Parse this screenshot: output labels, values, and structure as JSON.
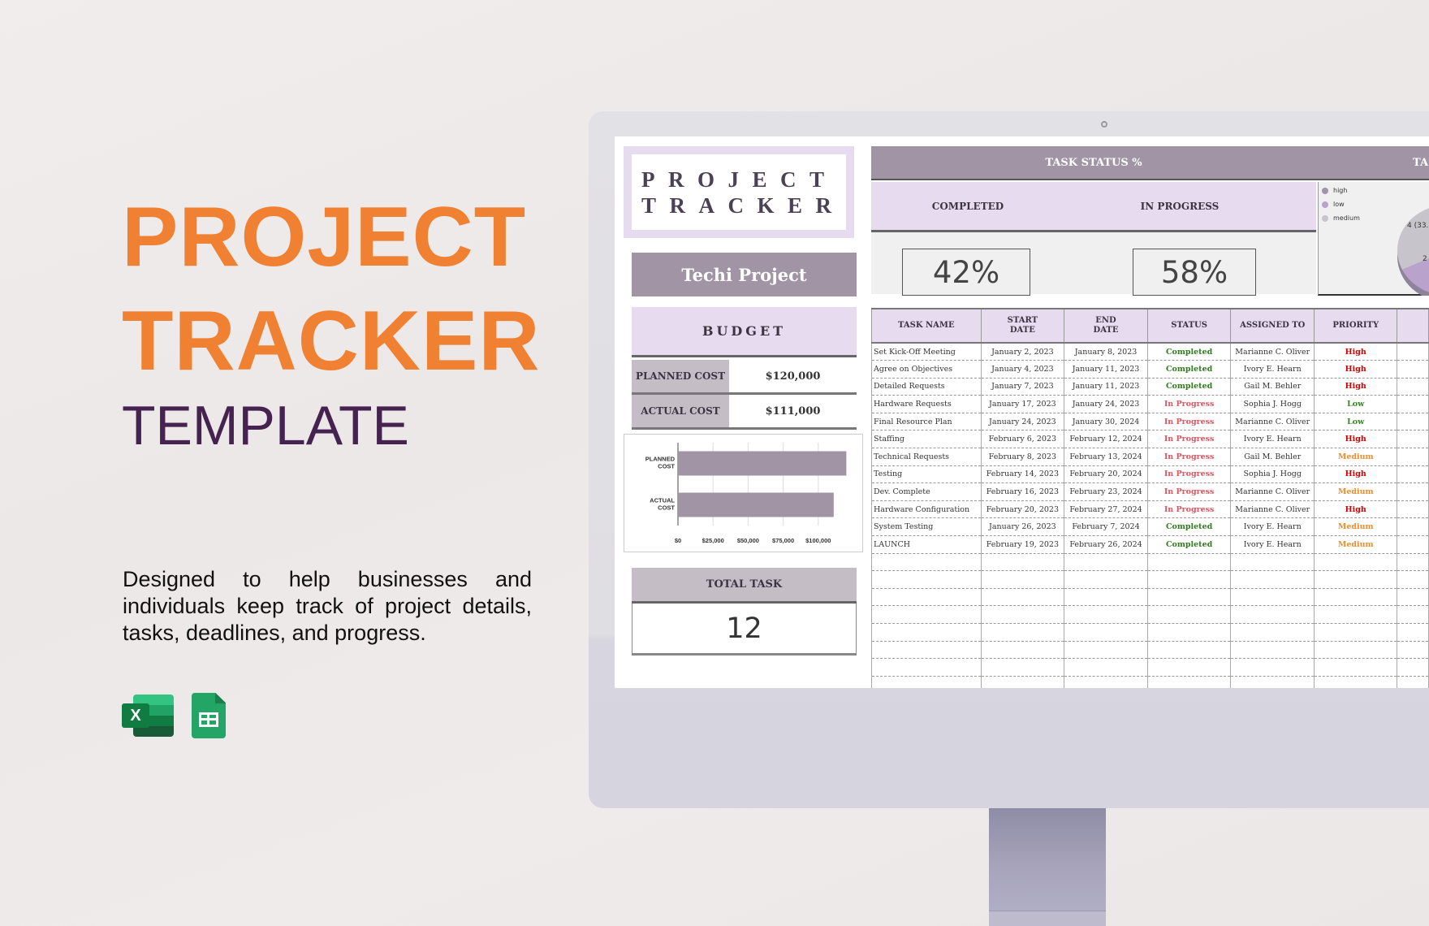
{
  "promo": {
    "title_line1": "PROJECT",
    "title_line2": "TRACKER",
    "subtitle": "TEMPLATE",
    "description": "Designed to help businesses and individuals keep track of project details, tasks, deadlines, and progress.",
    "colors": {
      "title": "#f18132",
      "subtitle": "#45224f"
    },
    "app_icons": [
      "excel-icon",
      "google-sheets-icon"
    ],
    "excel_letter": "X"
  },
  "tracker": {
    "logo_line1": "PROJECT",
    "logo_line2": "TRACKER",
    "project_name": "Techi Project",
    "budget": {
      "heading": "BUDGET",
      "rows": [
        {
          "label": "PLANNED COST",
          "value": "$120,000"
        },
        {
          "label": "ACTUAL COST",
          "value": "$111,000"
        }
      ]
    },
    "total_task": {
      "label": "TOTAL TASK",
      "value": "12"
    },
    "task_status": {
      "title": "TASK STATUS %",
      "title_right_partial": "TAS",
      "columns": [
        {
          "label": "COMPLETED",
          "value": "42%"
        },
        {
          "label": "IN PROGRESS",
          "value": "58%"
        }
      ]
    },
    "priority_chart": {
      "legend": [
        {
          "label": "high",
          "color": "#a093a8"
        },
        {
          "label": "low",
          "color": "#b9a3cc"
        },
        {
          "label": "medium",
          "color": "#c8c4cb"
        }
      ],
      "visible_labels": [
        "4 (33.",
        "2"
      ]
    },
    "table": {
      "headers": [
        "TASK NAME",
        "START\nDATE",
        "END\nDATE",
        "STATUS",
        "ASSIGNED TO",
        "PRIORITY",
        ""
      ],
      "rows": [
        {
          "name": "Set Kick-Off Meeting",
          "start": "January 2, 2023",
          "end": "January 8, 2023",
          "status": "Completed",
          "assigned": "Marianne C. Oliver",
          "priority": "High"
        },
        {
          "name": "Agree on Objectives",
          "start": "January 4, 2023",
          "end": "January 11, 2023",
          "status": "Completed",
          "assigned": "Ivory E. Hearn",
          "priority": "High"
        },
        {
          "name": "Detailed Requests",
          "start": "January 7, 2023",
          "end": "January 11, 2023",
          "status": "Completed",
          "assigned": "Gail M. Behler",
          "priority": "High"
        },
        {
          "name": "Hardware Requests",
          "start": "January 17, 2023",
          "end": "January 24, 2023",
          "status": "In Progress",
          "assigned": "Sophia J. Hogg",
          "priority": "Low"
        },
        {
          "name": "Final Resource Plan",
          "start": "January 24, 2023",
          "end": "January 30, 2024",
          "status": "In Progress",
          "assigned": "Marianne C. Oliver",
          "priority": "Low"
        },
        {
          "name": "Staffing",
          "start": "February 6, 2023",
          "end": "February 12, 2024",
          "status": "In Progress",
          "assigned": "Ivory E. Hearn",
          "priority": "High"
        },
        {
          "name": "Technical Requests",
          "start": "February 8, 2023",
          "end": "February 13, 2024",
          "status": "In Progress",
          "assigned": "Gail M. Behler",
          "priority": "Medium"
        },
        {
          "name": "Testing",
          "start": "February 14, 2023",
          "end": "February 20, 2024",
          "status": "In Progress",
          "assigned": "Sophia J. Hogg",
          "priority": "High"
        },
        {
          "name": "Dev. Complete",
          "start": "February 16, 2023",
          "end": "February 23, 2024",
          "status": "In Progress",
          "assigned": "Marianne C. Oliver",
          "priority": "Medium"
        },
        {
          "name": "Hardware Configuration",
          "start": "February 20, 2023",
          "end": "February 27, 2024",
          "status": "In Progress",
          "assigned": "Marianne C. Oliver",
          "priority": "High"
        },
        {
          "name": "System Testing",
          "start": "January 26, 2023",
          "end": "February 7, 2024",
          "status": "Completed",
          "assigned": "Ivory E. Hearn",
          "priority": "Medium"
        },
        {
          "name": "LAUNCH",
          "start": "February 19, 2023",
          "end": "February 26, 2024",
          "status": "Completed",
          "assigned": "Ivory E. Hearn",
          "priority": "Medium"
        }
      ],
      "empty_rows": 8
    },
    "colors": {
      "header_mauve": "#a094a5",
      "header_lilac": "#e7dbef",
      "label_gray": "#c4bdc6",
      "status_completed": "#2f7d1e",
      "status_in_progress": "#e0545e",
      "priority_high": "#d40000",
      "priority_low": "#2f8a1e",
      "priority_medium": "#ef8c2a"
    }
  },
  "chart_data": {
    "type": "bar",
    "orientation": "horizontal",
    "title": "",
    "categories": [
      "PLANNED\nCOST",
      "ACTUAL\nCOST"
    ],
    "values": [
      120000,
      111000
    ],
    "xlabel": "",
    "ylabel": "",
    "xlim": [
      0,
      125000
    ],
    "xticks": [
      0,
      25000,
      50000,
      75000,
      100000
    ],
    "xtick_labels": [
      "$0",
      "$25,000",
      "$50,000",
      "$75,000",
      "$100,000"
    ],
    "bar_color": "#a094a5",
    "grid": true,
    "legend": "none"
  }
}
